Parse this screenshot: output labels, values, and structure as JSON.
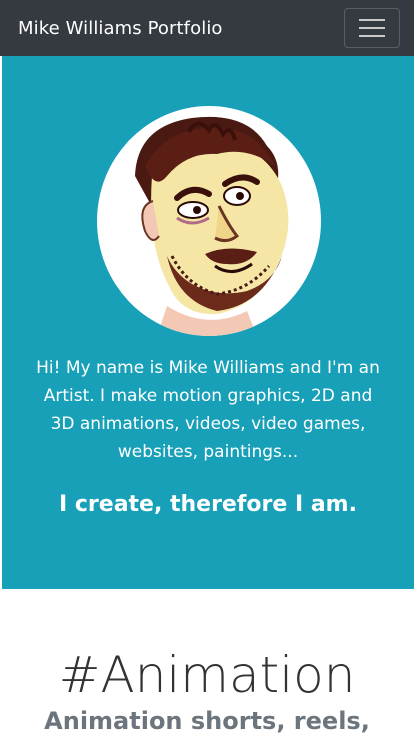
{
  "navbar": {
    "brand": "Mike Williams Portfolio",
    "toggler_icon": "hamburger-menu-icon",
    "background": "#343a40"
  },
  "hero": {
    "background": "#17a0b8",
    "avatar_icon": "caricature-portrait",
    "intro": "Hi! My name is Mike Williams and I'm an Artist. I make motion graphics, 2D and 3D animations, videos, video games, websites, paintings...",
    "tagline": "I create, therefore I am."
  },
  "section": {
    "title": "#Animation",
    "subtitle": "Animation shorts, reels,"
  }
}
